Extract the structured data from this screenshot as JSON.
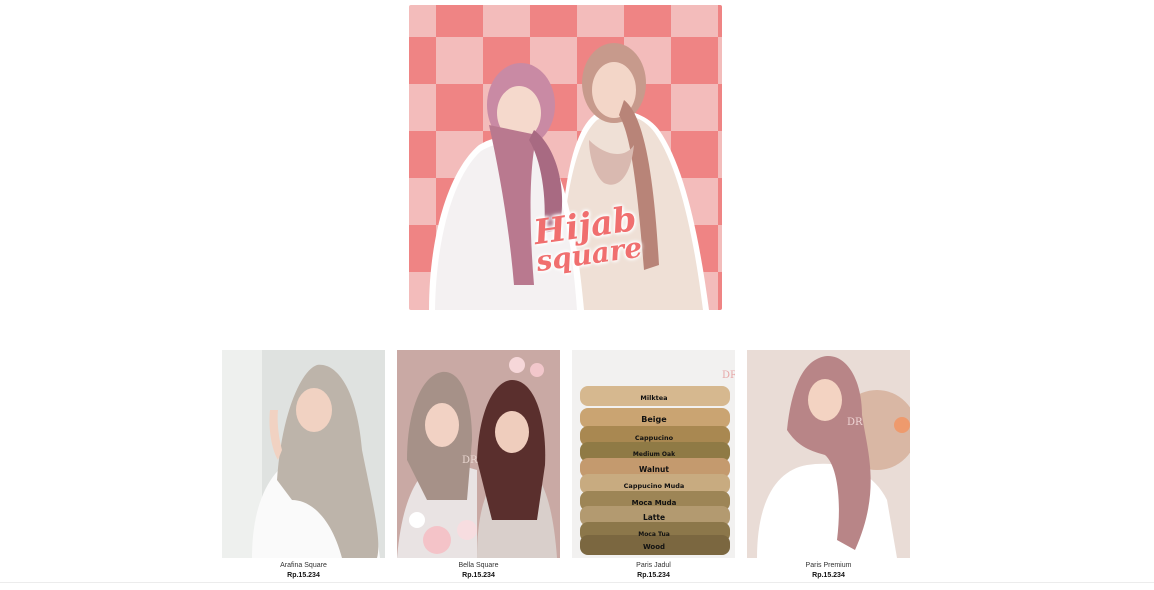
{
  "hero": {
    "title_line1": "Hijab",
    "title_line2": "square",
    "colors": {
      "pink_dark": "#ef8484",
      "pink_light": "#f3bcbb",
      "title": "#f06f6f"
    }
  },
  "products": [
    {
      "name": "Arafina Square",
      "price": "Rp.15.234"
    },
    {
      "name": "Bella Square",
      "price": "Rp.15.234"
    },
    {
      "name": "Paris Jadul",
      "price": "Rp.15.234",
      "swatches": [
        "Milktea",
        "Beige",
        "Cappucino",
        "Medium Oak",
        "Walnut",
        "Cappucino Muda",
        "Moca Muda",
        "Latte",
        "Moca Tua",
        "Wood"
      ]
    },
    {
      "name": "Paris Premium",
      "price": "Rp.15.234"
    }
  ],
  "brand_mark": "DR"
}
